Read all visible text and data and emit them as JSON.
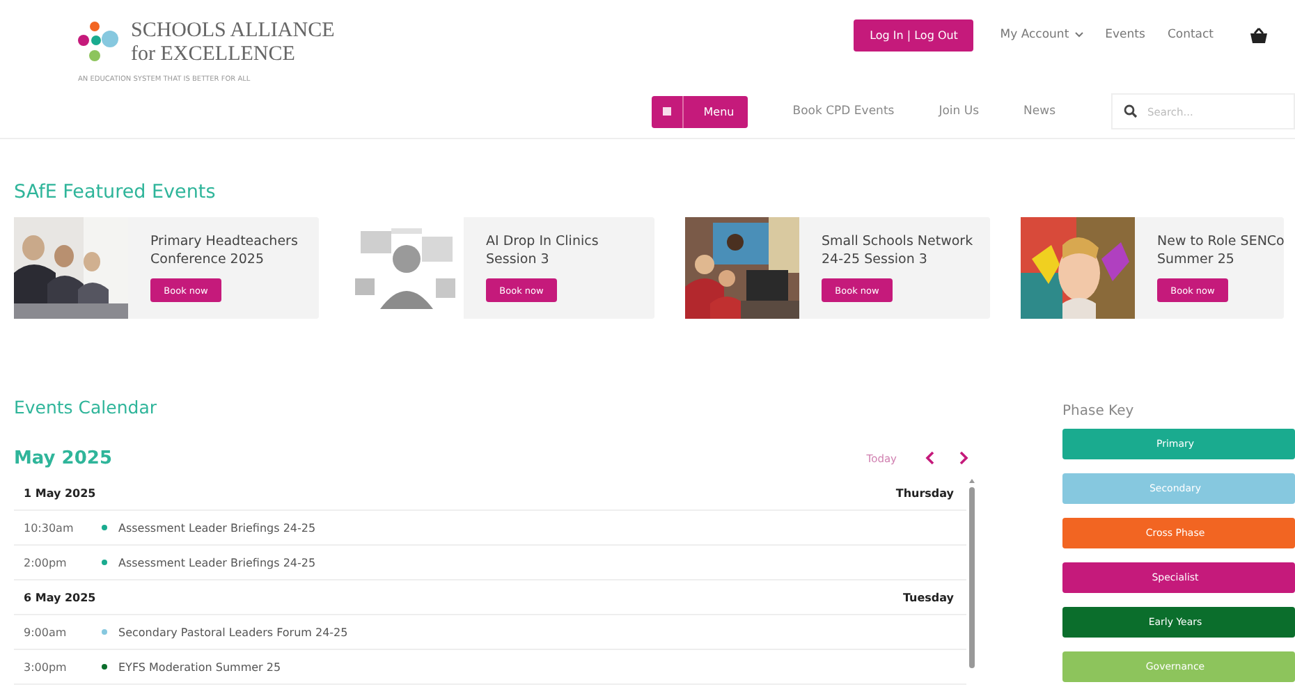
{
  "header": {
    "logo": {
      "name_line_1": "SCHOOLS ALLIANCE",
      "name_line_2": "for EXCELLENCE",
      "tagline": "AN EDUCATION SYSTEM THAT IS BETTER FOR ALL"
    },
    "login_button": "Log In | Log Out",
    "top_links": [
      {
        "label": "My Account",
        "dropdown": true
      },
      {
        "label": "Events",
        "dropdown": false
      },
      {
        "label": "Contact",
        "dropdown": false
      }
    ],
    "menu_button": "Menu",
    "nav_links": [
      "Book CPD Events",
      "Join Us",
      "News"
    ],
    "search": {
      "placeholder": "Search..."
    }
  },
  "featured": {
    "title": "SAfE Featured Events",
    "events": [
      {
        "title": "Primary Headteachers Conference 2025",
        "button": "Book now"
      },
      {
        "title": "AI Drop In Clinics Session 3",
        "button": "Book now"
      },
      {
        "title": "Small Schools Network 24-25 Session 3",
        "button": "Book now"
      },
      {
        "title": "New to Role SENCo Summer 25",
        "button": "Book now"
      }
    ]
  },
  "calendar": {
    "title": "Events Calendar",
    "month": "May 2025",
    "today_button": "Today",
    "rows": [
      {
        "kind": "date",
        "date": "1 May 2025",
        "weekday": "Thursday"
      },
      {
        "kind": "event",
        "time": "10:30am",
        "name": "Assessment Leader Briefings 24-25",
        "color": "#1aab8f"
      },
      {
        "kind": "event",
        "time": "2:00pm",
        "name": "Assessment Leader Briefings 24-25",
        "color": "#1aab8f"
      },
      {
        "kind": "date",
        "date": "6 May 2025",
        "weekday": "Tuesday"
      },
      {
        "kind": "event",
        "time": "9:00am",
        "name": "Secondary Pastoral Leaders Forum 24-25",
        "color": "#86c8df"
      },
      {
        "kind": "event",
        "time": "3:00pm",
        "name": "EYFS Moderation Summer 25",
        "color": "#0b6e2c"
      }
    ]
  },
  "phase_key": {
    "title": "Phase Key",
    "phases": [
      {
        "label": "Primary",
        "color": "#1aab8f"
      },
      {
        "label": "Secondary",
        "color": "#86c8df"
      },
      {
        "label": "Cross Phase",
        "color": "#f26522"
      },
      {
        "label": "Specialist",
        "color": "#c51a7b"
      },
      {
        "label": "Early Years",
        "color": "#0b6e2c"
      },
      {
        "label": "Governance",
        "color": "#8dc45c"
      }
    ]
  }
}
